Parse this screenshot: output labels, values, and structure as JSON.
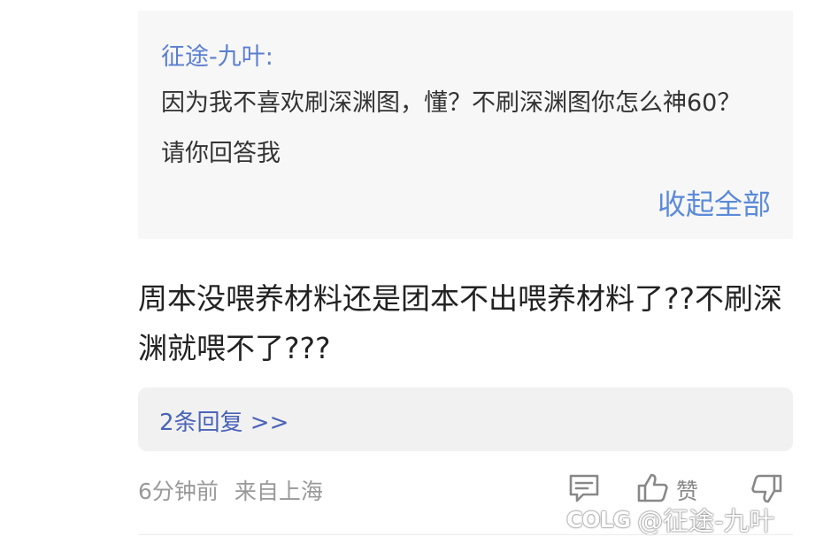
{
  "quote": {
    "author": "征途-九叶:",
    "text": "因为我不喜欢刷深渊图，懂？不刷深渊图你怎么神60？请你回答我",
    "collapse_label": "收起全部"
  },
  "comment": {
    "text": "周本没喂养材料还是团本不出喂养材料了??不刷深渊就喂不了???"
  },
  "replies": {
    "label": "2条回复 >>"
  },
  "meta": {
    "time": "6分钟前",
    "location": "来自上海"
  },
  "actions": {
    "reply_icon": "comment-icon",
    "like_icon": "thumbs-up-icon",
    "like_label": "赞",
    "dislike_icon": "thumbs-down-icon"
  },
  "watermark": {
    "logo": "COLG",
    "text": "@征途-九叶"
  },
  "colors": {
    "accent": "#5a8ad9",
    "author": "#5b7fcf",
    "reply_link": "#4a63b8",
    "muted": "#999999"
  }
}
